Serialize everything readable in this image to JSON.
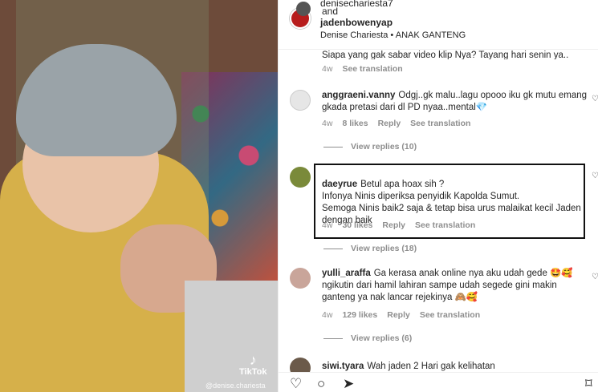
{
  "header": {
    "line1": "denisechariesta7",
    "and": "and",
    "user2": "jadenbowenyap",
    "subtitle": "Denise Chariesta • ANAK GANTENG"
  },
  "media": {
    "watermark": "TikTok",
    "handle": "@denise.chariesta"
  },
  "comments": [
    {
      "user": "",
      "text": "Siapa yang gak sabar video klip Nya? Tayang hari senin ya..",
      "time": "4w",
      "likes": "",
      "reply": "",
      "see_translation": "See translation"
    },
    {
      "user": "anggraeni.vanny",
      "text": "Odgj..gk malu..lagu opooo iku gk mutu emang gkada pretasi dari dl PD nyaa..mental💎",
      "time": "4w",
      "likes": "8 likes",
      "reply": "Reply",
      "see_translation": "See translation",
      "view_replies": "View replies (10)"
    },
    {
      "user": "daeyrue",
      "text": "Betul apa hoax sih ?\nInfonya Ninis diperiksa penyidik Kapolda Sumut.\nSemoga Ninis baik2 saja & tetap bisa urus malaikat kecil Jaden dengan baik",
      "time": "4w",
      "likes": "30 likes",
      "reply": "Reply",
      "see_translation": "See translation",
      "view_replies": "View replies (18)"
    },
    {
      "user": "yulli_araffa",
      "text": "Ga kerasa anak online nya aku udah gede 🤩🥰 ngikutin dari hamil lahiran sampe udah segede gini makin ganteng ya nak lancar rejekinya 🙈🥰",
      "time": "4w",
      "likes": "129 likes",
      "reply": "Reply",
      "see_translation": "See translation",
      "view_replies": "View replies (6)"
    },
    {
      "user": "siwi.tyara",
      "text": "Wah jaden 2 Hari gak kelihatan",
      "time": "",
      "likes": "",
      "reply": "",
      "see_translation": ""
    }
  ],
  "icons": {
    "heart": "heart-icon",
    "comment": "comment-icon",
    "share": "share-icon",
    "bookmark": "bookmark-icon"
  },
  "colors": {
    "meta": "#8e8e8e",
    "text": "#262626"
  }
}
